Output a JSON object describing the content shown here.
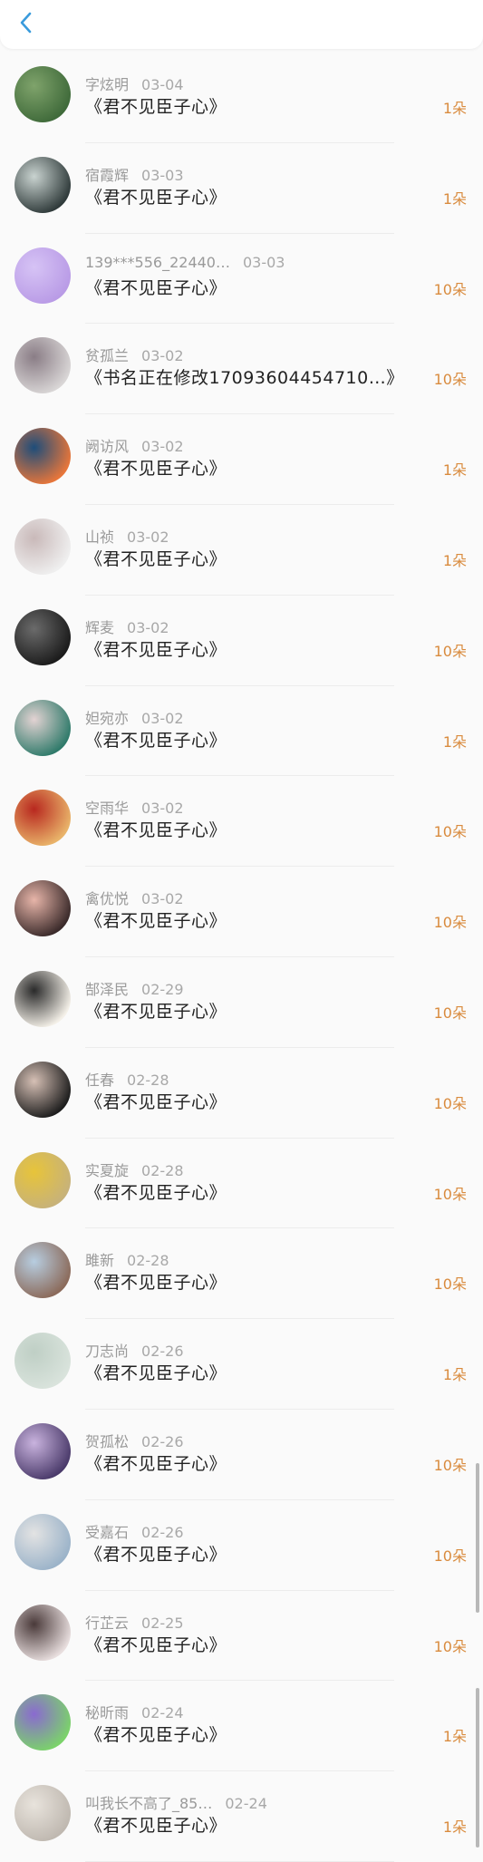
{
  "header": {
    "back_icon": "chevron-left-icon"
  },
  "entries": [
    {
      "name": "字炫明",
      "date": "03-04",
      "title": "《君不见臣子心》",
      "amount": "1朵",
      "avatar_colors": [
        "#3f6a3a",
        "#7fa36b"
      ]
    },
    {
      "name": "宿霞辉",
      "date": "03-03",
      "title": "《君不见臣子心》",
      "amount": "1朵",
      "avatar_colors": [
        "#2f3a3a",
        "#c9d3d0"
      ]
    },
    {
      "name": "139***556_22440…",
      "date": "03-03",
      "title": "《君不见臣子心》",
      "amount": "10朵",
      "avatar_colors": [
        "#b99be6",
        "#d6c3f5"
      ]
    },
    {
      "name": "贫孤兰",
      "date": "03-02",
      "title": "《书名正在修改17093604454710…》",
      "amount": "10朵",
      "avatar_colors": [
        "#d9d6d6",
        "#8a7d86"
      ]
    },
    {
      "name": "阙访风",
      "date": "03-02",
      "title": "《君不见臣子心》",
      "amount": "1朵",
      "avatar_colors": [
        "#e8763a",
        "#1e4d7a"
      ]
    },
    {
      "name": "山祯",
      "date": "03-02",
      "title": "《君不见臣子心》",
      "amount": "1朵",
      "avatar_colors": [
        "#efefef",
        "#c9b9b9"
      ]
    },
    {
      "name": "辉麦",
      "date": "03-02",
      "title": "《君不见臣子心》",
      "amount": "10朵",
      "avatar_colors": [
        "#1b1b1b",
        "#6b6b6b"
      ]
    },
    {
      "name": "妲宛亦",
      "date": "03-02",
      "title": "《君不见臣子心》",
      "amount": "1朵",
      "avatar_colors": [
        "#2f7a6a",
        "#e3d3d3"
      ]
    },
    {
      "name": "空雨华",
      "date": "03-02",
      "title": "《君不见臣子心》",
      "amount": "10朵",
      "avatar_colors": [
        "#e9b46a",
        "#b8281f"
      ]
    },
    {
      "name": "禽优悦",
      "date": "03-02",
      "title": "《君不见臣子心》",
      "amount": "10朵",
      "avatar_colors": [
        "#3a2a2a",
        "#e7b5a9"
      ]
    },
    {
      "name": "郜泽民",
      "date": "02-29",
      "title": "《君不见臣子心》",
      "amount": "10朵",
      "avatar_colors": [
        "#f4f0e8",
        "#2a2a2a"
      ]
    },
    {
      "name": "任春",
      "date": "02-28",
      "title": "《君不见臣子心》",
      "amount": "10朵",
      "avatar_colors": [
        "#1d1d1d",
        "#d6c0b5"
      ]
    },
    {
      "name": "实夏旋",
      "date": "02-28",
      "title": "《君不见臣子心》",
      "amount": "10朵",
      "avatar_colors": [
        "#c7b27a",
        "#e7c43a"
      ]
    },
    {
      "name": "雎新",
      "date": "02-28",
      "title": "《君不见臣子心》",
      "amount": "10朵",
      "avatar_colors": [
        "#8b6a5a",
        "#b7cde0"
      ]
    },
    {
      "name": "刀志尚",
      "date": "02-26",
      "title": "《君不见臣子心》",
      "amount": "1朵",
      "avatar_colors": [
        "#d9e3dc",
        "#bfcfc5"
      ]
    },
    {
      "name": "贺孤松",
      "date": "02-26",
      "title": "《君不见臣子心》",
      "amount": "10朵",
      "avatar_colors": [
        "#4a3a6a",
        "#c9b3de"
      ]
    },
    {
      "name": "受嘉石",
      "date": "02-26",
      "title": "《君不见臣子心》",
      "amount": "10朵",
      "avatar_colors": [
        "#9bb3c9",
        "#e3e3e3"
      ]
    },
    {
      "name": "行芷云",
      "date": "02-25",
      "title": "《君不见臣子心》",
      "amount": "10朵",
      "avatar_colors": [
        "#e8dede",
        "#4a3a3a"
      ]
    },
    {
      "name": "秘昕雨",
      "date": "02-24",
      "title": "《君不见臣子心》",
      "amount": "1朵",
      "avatar_colors": [
        "#7bd36a",
        "#8a6ad0"
      ]
    },
    {
      "name": "叫我长不高了_85…",
      "date": "02-24",
      "title": "《君不见臣子心》",
      "amount": "1朵",
      "avatar_colors": [
        "#bfb8b0",
        "#e8e3dc"
      ]
    }
  ]
}
